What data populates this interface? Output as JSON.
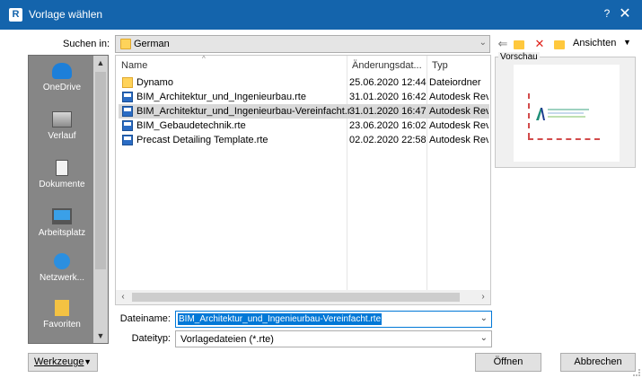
{
  "window": {
    "title": "Vorlage wählen",
    "app_icon_letter": "R",
    "help_label": "?",
    "close_label": "✕"
  },
  "lookin": {
    "label": "Suchen in:",
    "value": "German"
  },
  "toolbar": {
    "views_label": "Ansichten",
    "icons": [
      "back-arrow-icon",
      "up-folder-icon",
      "delete-icon",
      "new-folder-icon"
    ]
  },
  "places": [
    {
      "label": "OneDrive",
      "icon": "cloud-icon"
    },
    {
      "label": "Verlauf",
      "icon": "history-icon"
    },
    {
      "label": "Dokumente",
      "icon": "documents-icon"
    },
    {
      "label": "Arbeitsplatz",
      "icon": "computer-icon"
    },
    {
      "label": "Netzwerk...",
      "icon": "network-icon"
    },
    {
      "label": "Favoriten",
      "icon": "favorites-icon"
    }
  ],
  "filelist": {
    "columns": [
      "Name",
      "Änderungsdat...",
      "Typ"
    ],
    "rows": [
      {
        "name": "Dynamo",
        "date": "25.06.2020 12:44",
        "type": "Dateiordner",
        "icon": "folder-icon",
        "selected": false
      },
      {
        "name": "BIM_Architektur_und_Ingenieurbau.rte",
        "date": "31.01.2020 16:42",
        "type": "Autodesk Revit",
        "icon": "rte-file-icon",
        "selected": false
      },
      {
        "name": "BIM_Architektur_und_Ingenieurbau-Vereinfacht.rte",
        "date": "31.01.2020 16:47",
        "type": "Autodesk Revit",
        "icon": "rte-file-icon",
        "selected": true
      },
      {
        "name": "BIM_Gebaudetechnik.rte",
        "date": "23.06.2020 16:02",
        "type": "Autodesk Revit",
        "icon": "rte-file-icon",
        "selected": false
      },
      {
        "name": "Precast Detailing Template.rte",
        "date": "02.02.2020 22:58",
        "type": "Autodesk Revit",
        "icon": "rte-file-icon",
        "selected": false
      }
    ]
  },
  "preview": {
    "label": "Vorschau"
  },
  "filename": {
    "label": "Dateiname:",
    "value": "BIM_Architektur_und_Ingenieurbau-Vereinfacht.rte"
  },
  "filetype": {
    "label": "Dateityp:",
    "value": "Vorlagedateien  (*.rte)"
  },
  "buttons": {
    "tools": "Werkzeuge",
    "open": "Öffnen",
    "cancel": "Abbrechen"
  },
  "colors": {
    "titlebar": "#1464ac",
    "selection": "#0078d7",
    "places_bg": "#868686"
  }
}
